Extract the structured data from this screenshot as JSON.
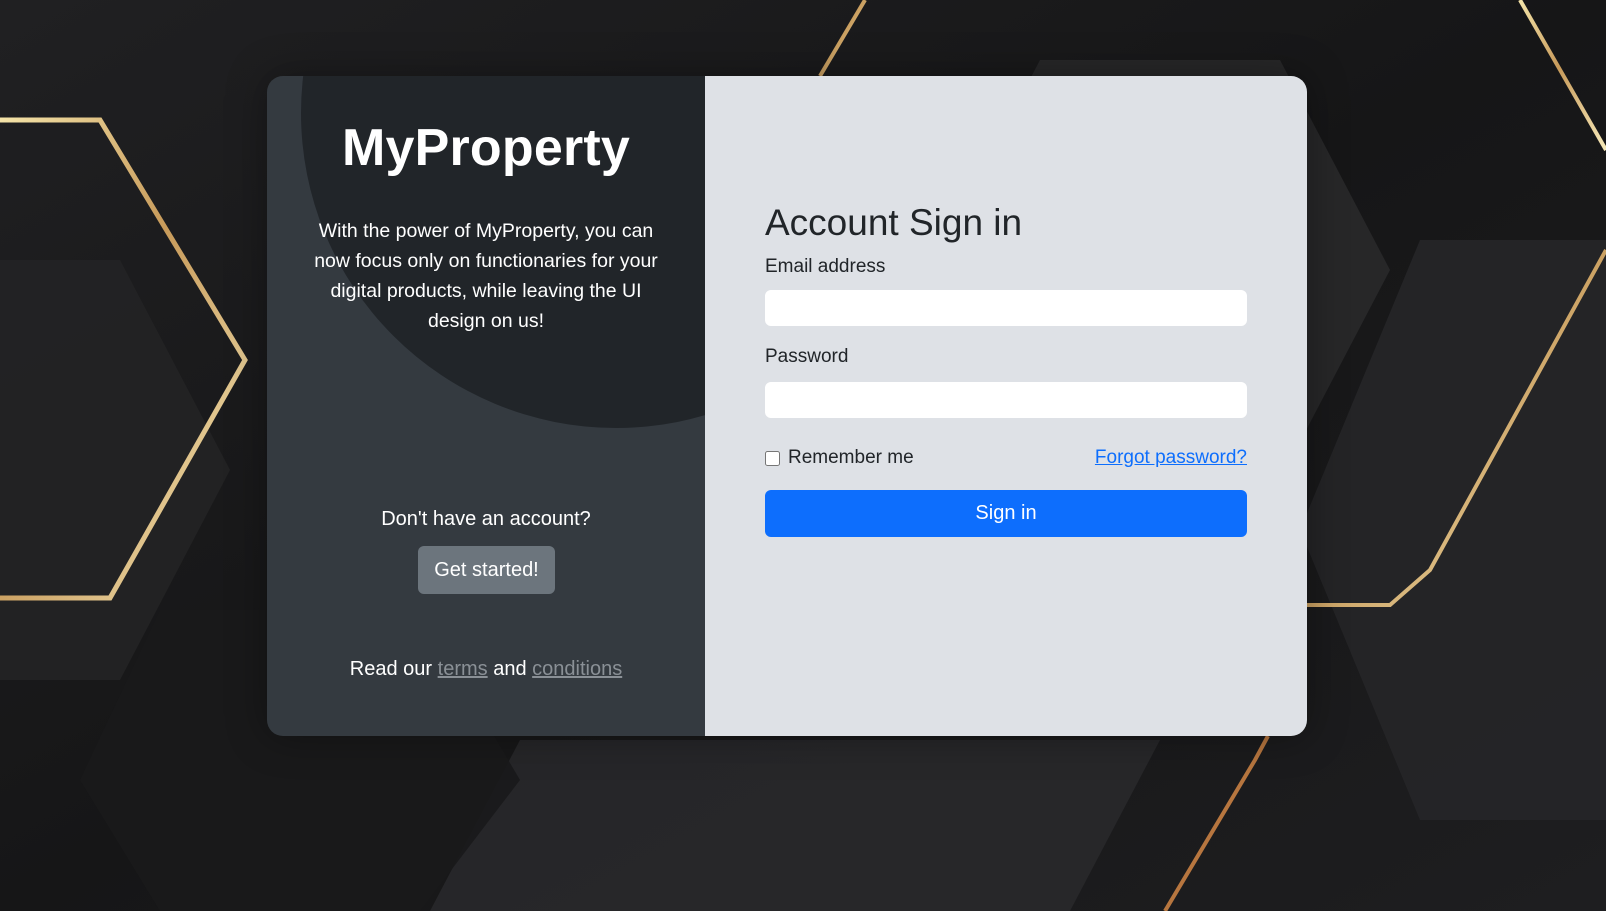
{
  "brand": {
    "title": "MyProperty",
    "blurb": "With the power of MyProperty, you can now focus only on functionaries for your digital products, while leaving the UI design on us!"
  },
  "signup": {
    "prompt": "Don't have an account?",
    "button_label": "Get started!"
  },
  "terms": {
    "prefix": "Read our",
    "terms_link": "terms",
    "conjunction": "and",
    "conditions_link": "conditions"
  },
  "signin": {
    "title": "Account Sign in",
    "email_label": "Email address",
    "email_value": "",
    "password_label": "Password",
    "password_value": "",
    "remember_label": "Remember me",
    "remember_checked": false,
    "forgot_label": "Forgot password?",
    "submit_label": "Sign in"
  },
  "colors": {
    "primary": "#0d6efd",
    "secondary": "#6c757d",
    "dark_panel": "#343a40",
    "darker_panel": "#212529",
    "light_panel": "#dee1e6",
    "gold_accent": "#d8b775"
  }
}
